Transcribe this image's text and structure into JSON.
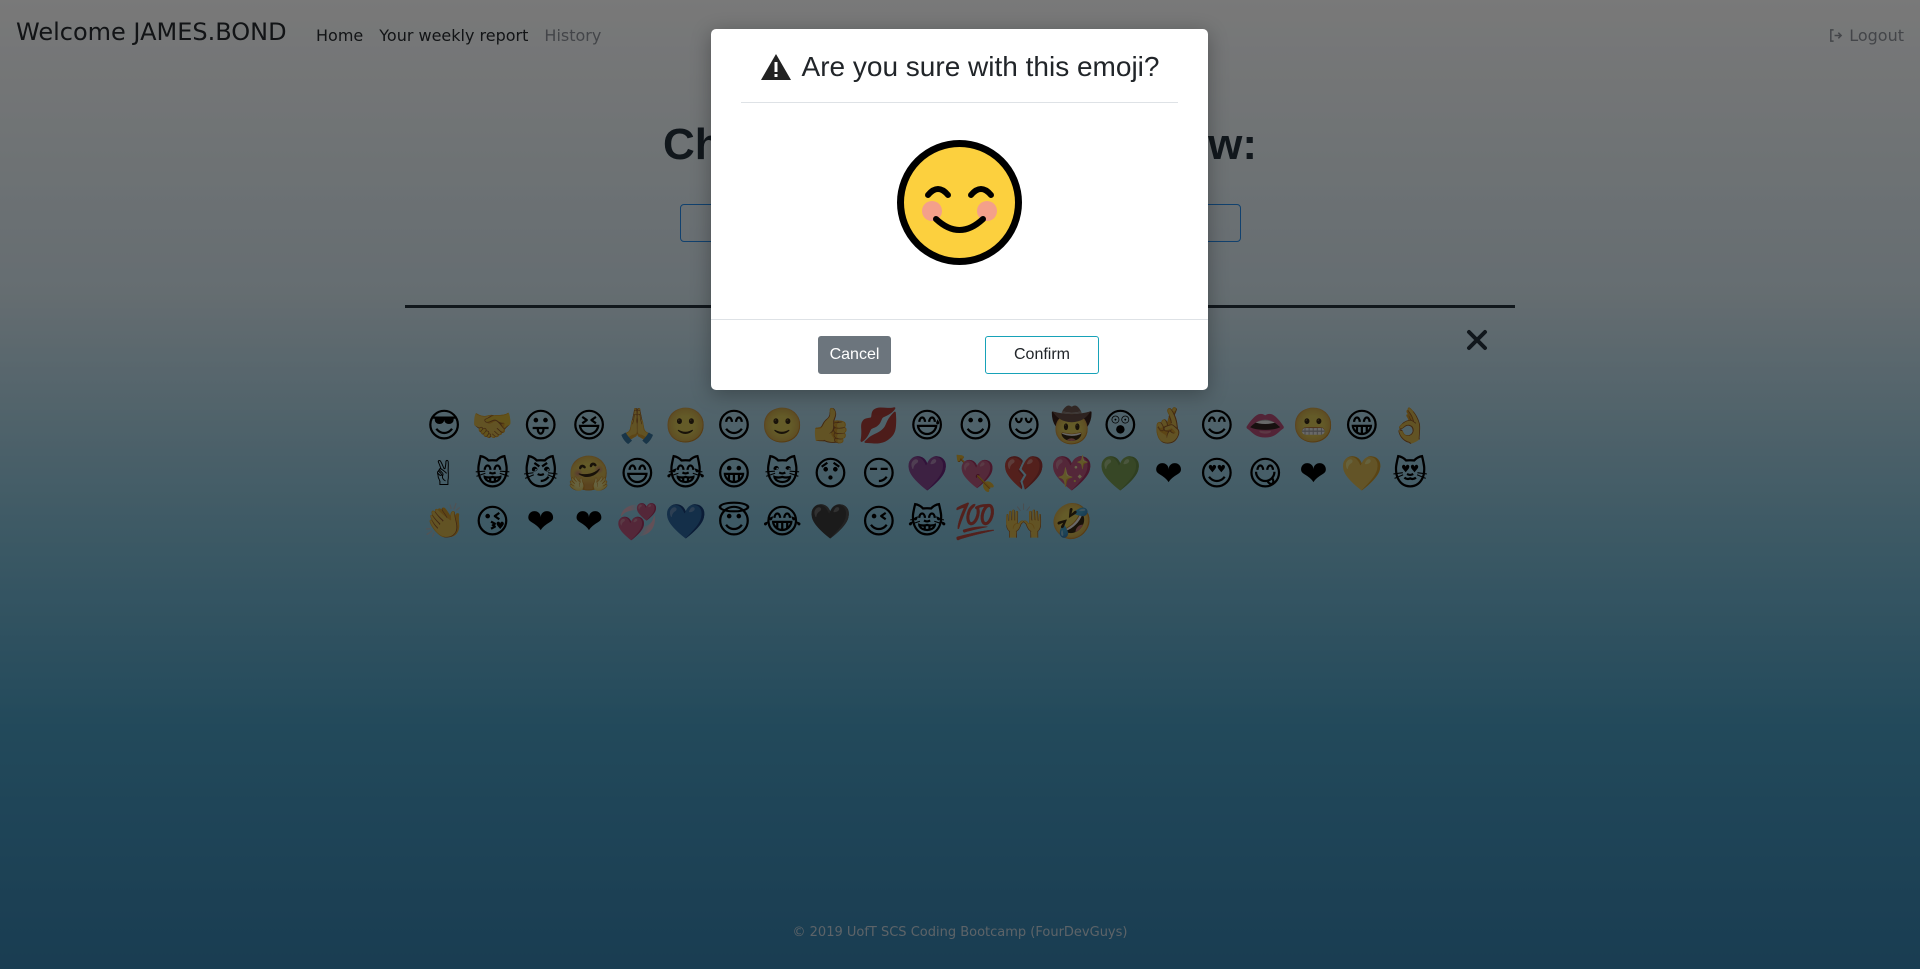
{
  "navbar": {
    "brand": "Welcome JAMES.BOND",
    "links": [
      "Home",
      "Your weekly report",
      "History"
    ],
    "logout": "Logout"
  },
  "main": {
    "headline": "Choose that ... ng right now:"
  },
  "emojis": [
    "😎",
    "🤝",
    "😛",
    "😆",
    "🙏",
    "🙂",
    "😊",
    "🙂",
    "👍",
    "💋",
    "😅",
    "☺",
    "😌",
    "🤠",
    "😲",
    "🤞",
    "😊",
    "👄",
    "😬",
    "😁",
    "👌",
    "✌",
    "😸",
    "😼",
    "🤗",
    "😄",
    "😹",
    "😀",
    "😺",
    "😯",
    "😏",
    "💜",
    "💘",
    "💔",
    "💖",
    "💚",
    "❤",
    "😍",
    "😋",
    "❤",
    "💛",
    "😻",
    "👏",
    "😘",
    "❤",
    "❤",
    "💞",
    "💙",
    "😇",
    "😂",
    "🖤",
    "😉",
    "😹",
    "💯",
    "🙌",
    "🤣"
  ],
  "modal": {
    "title": "Are you sure with this emoji?",
    "cancel": "Cancel",
    "confirm": "Confirm"
  },
  "footer": "© 2019 UofT SCS Coding Bootcamp (FourDevGuys)"
}
